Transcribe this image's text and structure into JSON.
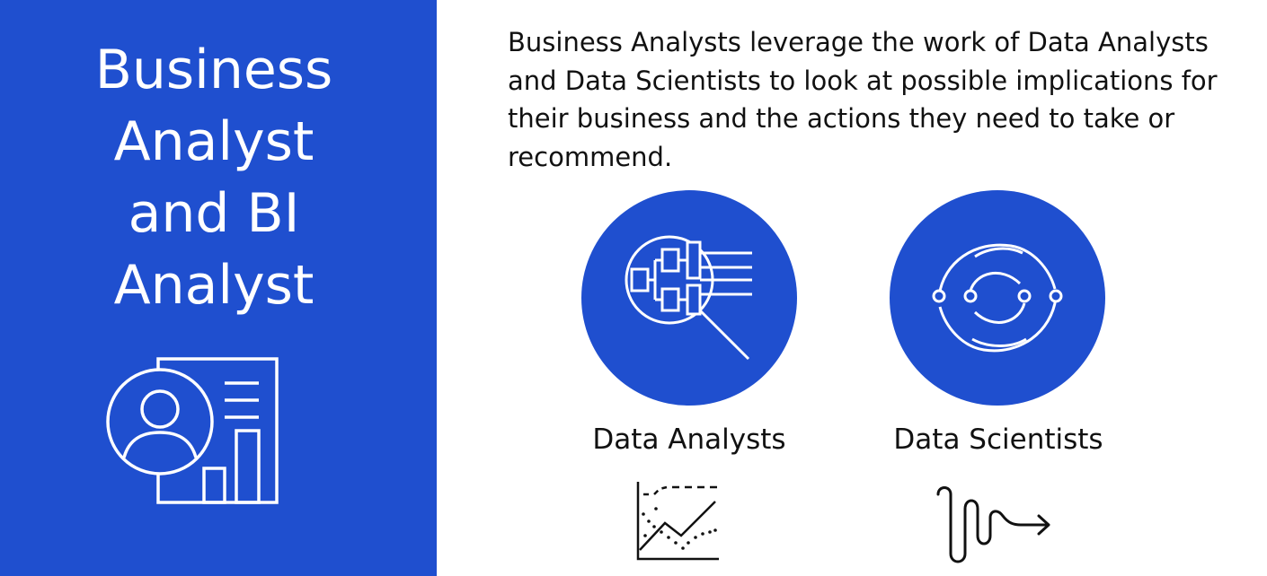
{
  "left_panel": {
    "title_lines": [
      "Business",
      "Analyst",
      "and BI",
      "Analyst"
    ],
    "icon": "business-analyst-report-icon",
    "background_color": "#1f4fcf"
  },
  "description": "Business Analysts leverage the work of Data Analysts and Data Scientists to look at possible implications for their business and the actions they need to take or recommend.",
  "roles": [
    {
      "label": "Data Analysts",
      "circle_icon": "magnifying-glass-flowchart-icon",
      "small_icon": "line-chart-scatter-icon"
    },
    {
      "label": "Data Scientists",
      "circle_icon": "circular-arrows-nodes-icon",
      "small_icon": "winding-path-arrow-icon"
    }
  ],
  "colors": {
    "accent_blue": "#1f4fcf",
    "text": "#111111",
    "background": "#ffffff"
  }
}
